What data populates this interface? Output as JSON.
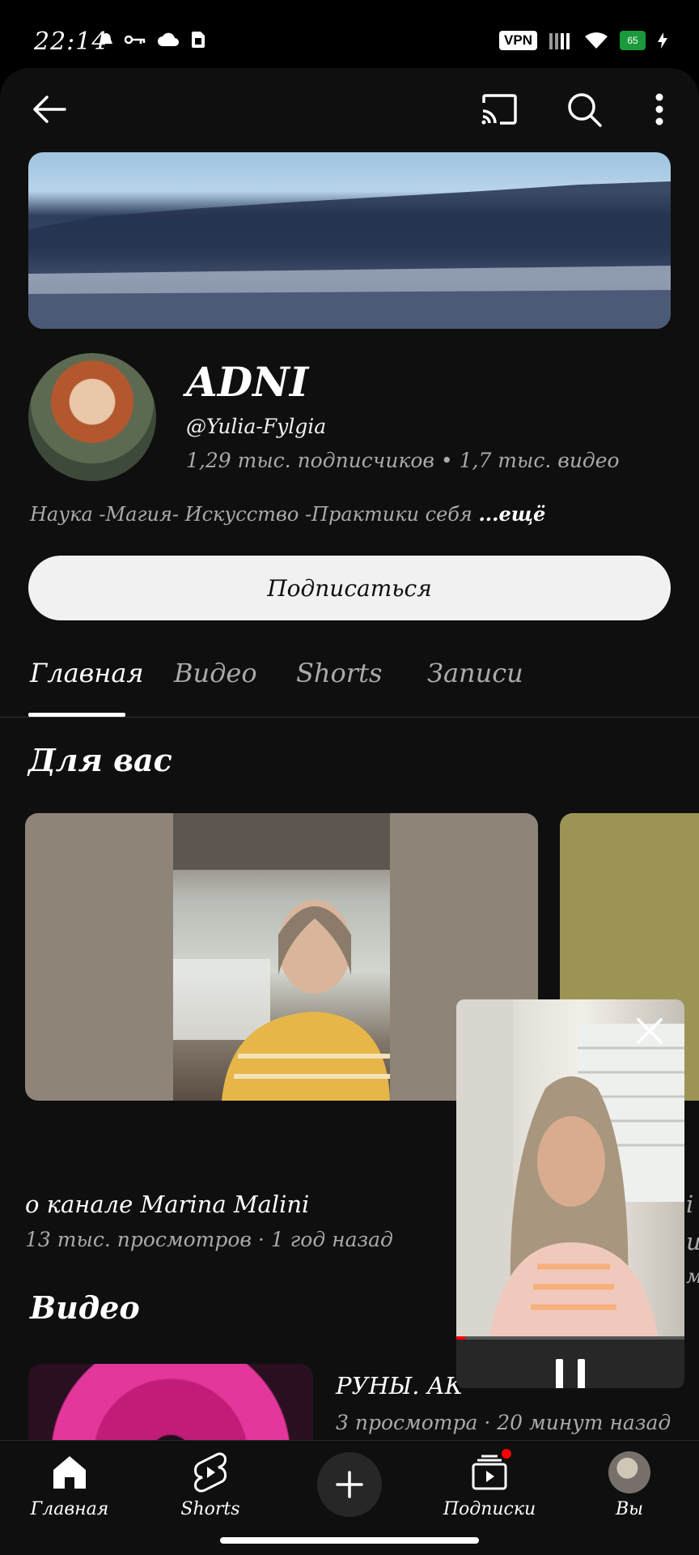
{
  "status_bar": {
    "time": "22:14",
    "vpn": "VPN",
    "battery": "65"
  },
  "channel": {
    "name": "ADNI",
    "handle": "@Yulia-Fylgia",
    "stats": "1,29 тыс. подписчиков • 1,7 тыс. видео",
    "description": "Наука -Магия- Искусство -Практики себя",
    "more": "...ещё",
    "subscribe_label": "Подписаться"
  },
  "tabs": [
    {
      "label": "Главная",
      "active": true
    },
    {
      "label": "Видео",
      "active": false
    },
    {
      "label": "Shorts",
      "active": false
    },
    {
      "label": "Записи",
      "active": false
    }
  ],
  "for_you": {
    "title": "Для вас",
    "video_title": "о канале Marina Malini",
    "video_meta": "13 тыс. просмотров · 1 год назад",
    "peek_line_1": "i",
    "peek_line_2": "ui",
    "peek_line_3": "мс"
  },
  "videos_section": {
    "title": "Видео",
    "video_title": "РУНЫ. АК",
    "video_meta": "3 просмотра · 20 минут назад"
  },
  "miniplayer": {
    "progress_percent": 4
  },
  "bottom_nav": [
    {
      "label": "Главная"
    },
    {
      "label": "Shorts"
    },
    {
      "label": "Подписки"
    },
    {
      "label": "Вы"
    }
  ]
}
